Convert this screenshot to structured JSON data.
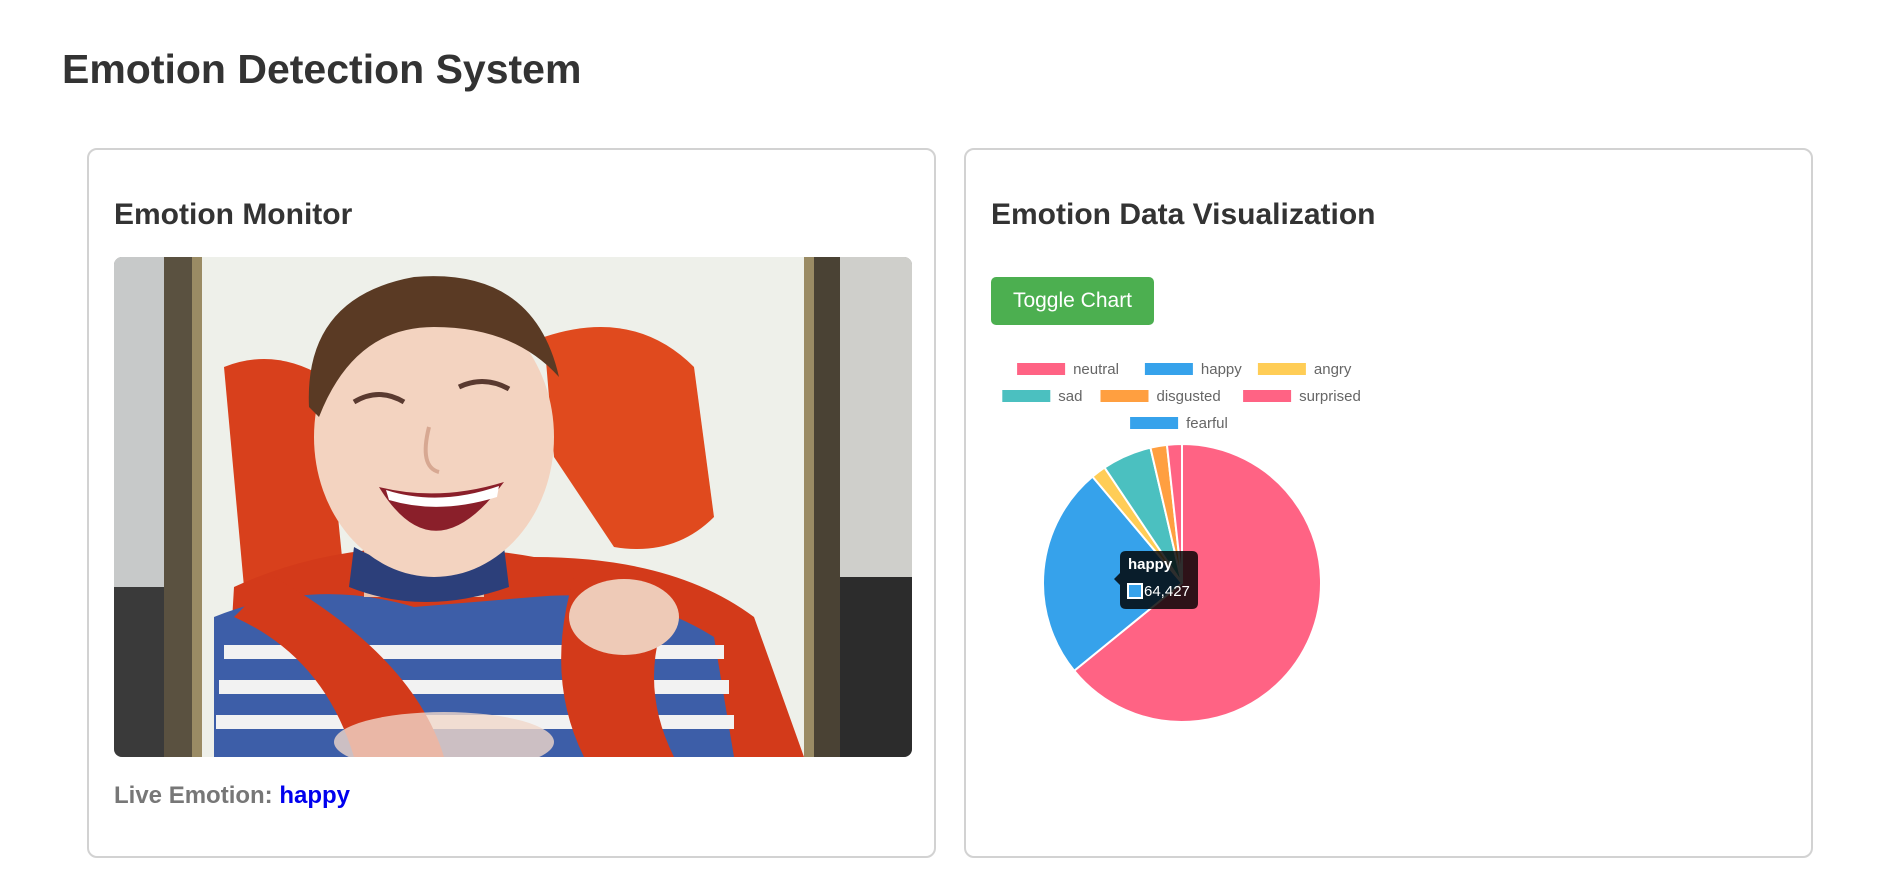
{
  "page": {
    "title": "Emotion Detection System"
  },
  "monitor": {
    "title": "Emotion Monitor",
    "live_label": "Live Emotion:",
    "live_value": "happy",
    "live_value_color": "#0000ee"
  },
  "visualization": {
    "title": "Emotion Data Visualization",
    "toggle_label": "Toggle Chart",
    "toggle_color": "#4caf50"
  },
  "chart_data": {
    "type": "pie",
    "categories": [
      "neutral",
      "happy",
      "angry",
      "sad",
      "disgusted",
      "surprised",
      "fearful"
    ],
    "values": [
      167000,
      64427,
      4500,
      15000,
      5000,
      4500,
      0
    ],
    "colors": [
      "#ff6384",
      "#36a2eb",
      "#ffcd56",
      "#4bc0c0",
      "#ff9f40",
      "#ff6384",
      "#36a2eb"
    ],
    "legend_position": "top",
    "tooltip": {
      "label": "happy",
      "value": "64,427"
    }
  }
}
